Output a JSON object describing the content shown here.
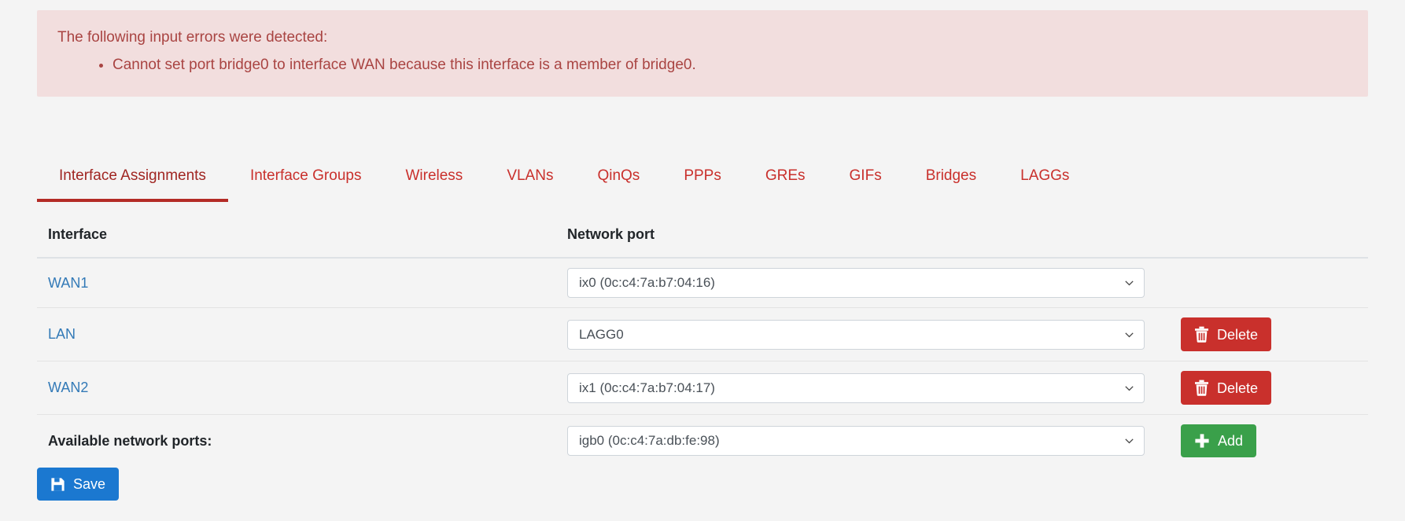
{
  "alert": {
    "title": "The following input errors were detected:",
    "errors": [
      "Cannot set port bridge0 to interface WAN because this interface is a member of bridge0."
    ],
    "bg_color": "#f2dede",
    "text_color": "#a94442"
  },
  "tabs": [
    {
      "label": "Interface Assignments",
      "active": true
    },
    {
      "label": "Interface Groups",
      "active": false
    },
    {
      "label": "Wireless",
      "active": false
    },
    {
      "label": "VLANs",
      "active": false
    },
    {
      "label": "QinQs",
      "active": false
    },
    {
      "label": "PPPs",
      "active": false
    },
    {
      "label": "GREs",
      "active": false
    },
    {
      "label": "GIFs",
      "active": false
    },
    {
      "label": "Bridges",
      "active": false
    },
    {
      "label": "LAGGs",
      "active": false
    }
  ],
  "tab_accent_color": "#b32b26",
  "table": {
    "headers": {
      "interface": "Interface",
      "network_port": "Network port"
    },
    "rows": [
      {
        "interface": "WAN1",
        "port_value": "ix0 (0c:c4:7a:b7:04:16)",
        "has_delete": false,
        "delete_label": ""
      },
      {
        "interface": "LAN",
        "port_value": "LAGG0",
        "has_delete": true,
        "delete_label": "Delete"
      },
      {
        "interface": "WAN2",
        "port_value": "ix1 (0c:c4:7a:b7:04:17)",
        "has_delete": true,
        "delete_label": "Delete"
      }
    ],
    "available": {
      "label": "Available network ports:",
      "port_value": "igb0 (0c:c4:7a:db:fe:98)",
      "add_label": "Add"
    }
  },
  "buttons": {
    "save_label": "Save",
    "save_color": "#1b78d0",
    "delete_color": "#c9302c",
    "add_color": "#3aa04a"
  },
  "icons": {
    "trash": "trash-icon",
    "plus": "plus-icon",
    "save": "floppy-disk-icon",
    "chevron": "chevron-down-icon"
  }
}
